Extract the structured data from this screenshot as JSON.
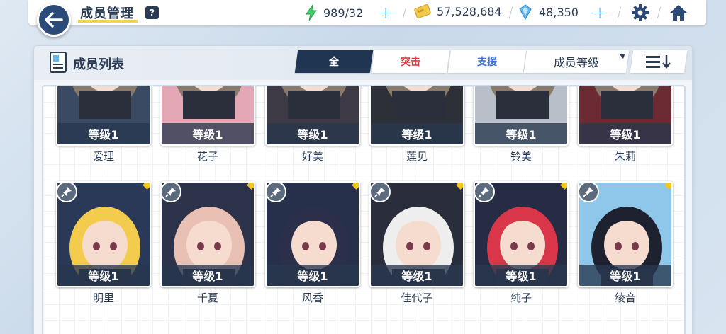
{
  "header": {
    "title": "成员管理",
    "help": "?",
    "energy": "989/32",
    "credits": "57,528,684",
    "gems": "48,350"
  },
  "panel": {
    "title": "成员列表",
    "tabs": [
      "全",
      "突击",
      "支援"
    ],
    "tab_colors": [
      "#ffffff",
      "#d9363e",
      "#3c6fd6"
    ],
    "sort_label": "成员等级"
  },
  "row1": [
    {
      "name": "爱理",
      "level": "等级1",
      "bg": "#3a4a63"
    },
    {
      "name": "花子",
      "level": "等级1",
      "bg": "#e3a7b5"
    },
    {
      "name": "好美",
      "level": "等级1",
      "bg": "#3d3a46"
    },
    {
      "name": "莲见",
      "level": "等级1",
      "bg": "#2d3036"
    },
    {
      "name": "铃美",
      "level": "等级1",
      "bg": "#b8bfc9"
    },
    {
      "name": "朱莉",
      "level": "等级1",
      "bg": "#6c2b33"
    }
  ],
  "row2": [
    {
      "name": "明里",
      "level": "等级1",
      "bg": "#2a3957",
      "hair": "#f4cc4d"
    },
    {
      "name": "千夏",
      "level": "等级1",
      "bg": "#2c324a",
      "hair": "#e8c1b4"
    },
    {
      "name": "风香",
      "level": "等级1",
      "bg": "#27304a",
      "hair": "#2c2f4a"
    },
    {
      "name": "佳代子",
      "level": "等级1",
      "bg": "#2a2e3c",
      "hair": "#eeeeee"
    },
    {
      "name": "纯子",
      "level": "等级1",
      "bg": "#262c44",
      "hair": "#d9364a"
    },
    {
      "name": "绫音",
      "level": "等级1",
      "bg": "#8fc7ea",
      "hair": "#1e2230"
    }
  ]
}
